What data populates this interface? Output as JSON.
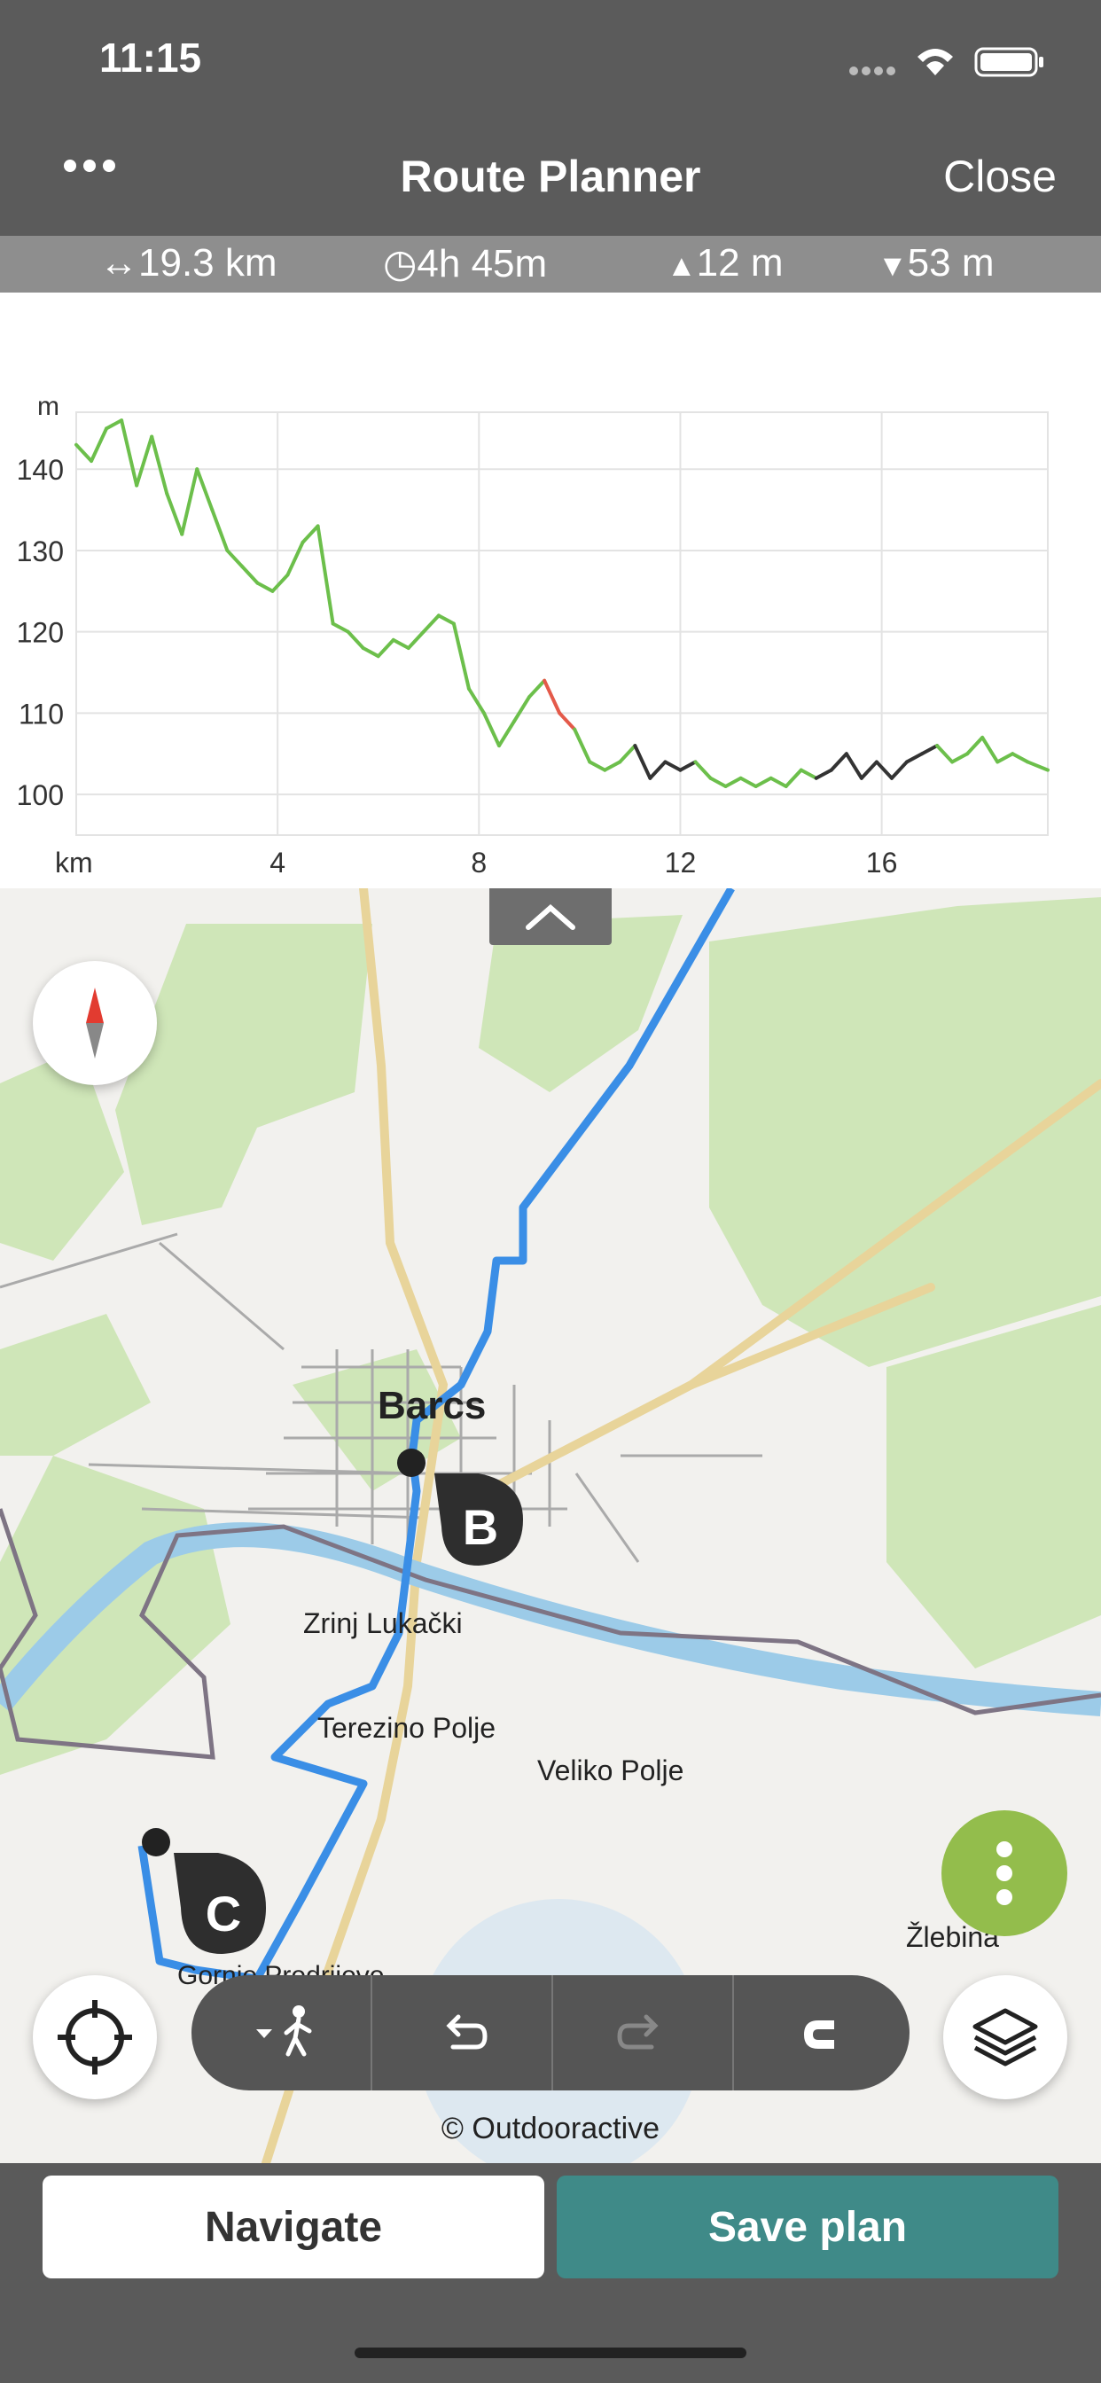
{
  "status": {
    "time": "11:15"
  },
  "header": {
    "title": "Route Planner",
    "close_label": "Close"
  },
  "stats": {
    "distance": "19.3 km",
    "duration": "4h 45m",
    "ascent": "12 m",
    "descent": "53 m"
  },
  "chart_data": {
    "type": "line",
    "ylabel": "m",
    "xlabel": "km",
    "xlim": [
      0,
      19.3
    ],
    "ylim": [
      95,
      147
    ],
    "xticks": [
      4,
      8,
      12,
      16
    ],
    "yticks": [
      100,
      110,
      120,
      130,
      140
    ],
    "series": [
      {
        "x": [
          0,
          0.3,
          0.6,
          0.9,
          1.2,
          1.5,
          1.8,
          2.1,
          2.4,
          2.7,
          3.0,
          3.3,
          3.6,
          3.9,
          4.2,
          4.5,
          4.8,
          5.1,
          5.4,
          5.7,
          6.0,
          6.3,
          6.6,
          6.9,
          7.2,
          7.5,
          7.8,
          8.1,
          8.4,
          8.7,
          9.0,
          9.3,
          9.6,
          9.9,
          10.2,
          10.5,
          10.8,
          11.1,
          11.4,
          11.7,
          12.0,
          12.3,
          12.6,
          12.9,
          13.2,
          13.5,
          13.8,
          14.1,
          14.4,
          14.7,
          15.0,
          15.3,
          15.6,
          15.9,
          16.2,
          16.5,
          16.8,
          17.1,
          17.4,
          17.7,
          18.0,
          18.3,
          18.6,
          18.9,
          19.3
        ],
        "y": [
          143,
          141,
          145,
          146,
          138,
          144,
          137,
          132,
          140,
          135,
          130,
          128,
          126,
          125,
          127,
          131,
          133,
          121,
          120,
          118,
          117,
          119,
          118,
          120,
          122,
          121,
          113,
          110,
          106,
          109,
          112,
          114,
          110,
          108,
          104,
          103,
          104,
          106,
          102,
          104,
          103,
          104,
          102,
          101,
          102,
          101,
          102,
          101,
          103,
          102,
          103,
          105,
          102,
          104,
          102,
          104,
          105,
          106,
          104,
          105,
          107,
          104,
          105,
          104,
          103
        ]
      }
    ],
    "colors": {
      "flat": "#6cbf4b",
      "steep": "#e45a4a",
      "unpaved": "#333333"
    }
  },
  "map": {
    "places": [
      {
        "name": "Barcs",
        "bold": true
      },
      {
        "name": "Zrinj Lukački"
      },
      {
        "name": "Terezino Polje"
      },
      {
        "name": "Veliko Polje"
      },
      {
        "name": "Žlebina"
      },
      {
        "name": "Gornje Predrijevo"
      }
    ],
    "waypoints": [
      "B",
      "C"
    ],
    "attribution": "© Outdooractive",
    "route_color": "#3a8ee6"
  },
  "toolbar": {
    "icons": [
      "walk-mode-icon",
      "undo-icon",
      "redo-icon",
      "magnet-icon"
    ]
  },
  "bottom": {
    "navigate_label": "Navigate",
    "save_label": "Save plan",
    "save_color": "#3f8a88"
  }
}
